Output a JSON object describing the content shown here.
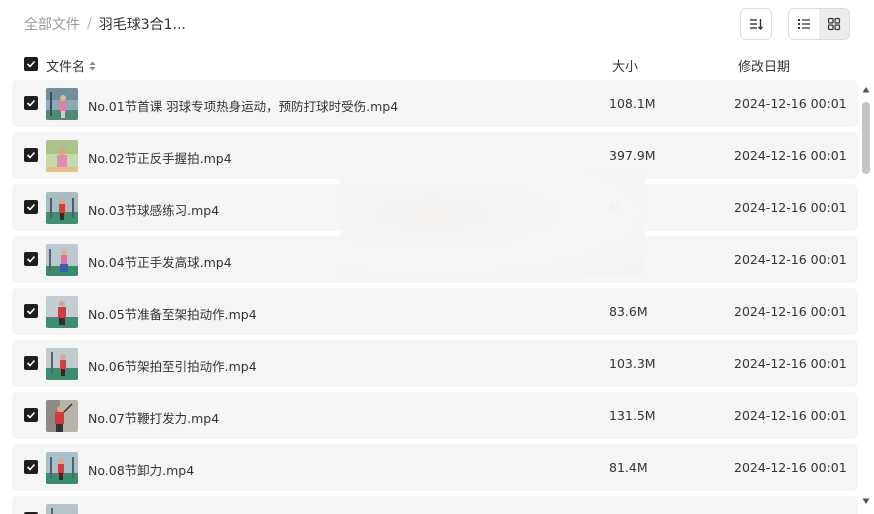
{
  "breadcrumb": {
    "root": "全部文件",
    "separator": "/",
    "current": "羽毛球3合1..."
  },
  "toolbar": {
    "sort_icon": "sort-icon",
    "list_view_icon": "list-view-icon",
    "grid_view_icon": "grid-view-icon"
  },
  "columns": {
    "name": "文件名",
    "size": "大小",
    "date": "修改日期"
  },
  "files": [
    {
      "name": "No.01节首课 羽球专项热身运动，预防打球时受伤.mp4",
      "size": "108.1M",
      "date": "2024-12-16 00:01"
    },
    {
      "name": "No.02节正反手握拍.mp4",
      "size": "397.9M",
      "date": "2024-12-16 00:01"
    },
    {
      "name": "No.03节球感练习.mp4",
      "size": "M",
      "date": "2024-12-16 00:01"
    },
    {
      "name": "No.04节正手发高球.mp4",
      "size": "",
      "date": "2024-12-16 00:01"
    },
    {
      "name": "No.05节准备至架拍动作.mp4",
      "size": "83.6M",
      "date": "2024-12-16 00:01"
    },
    {
      "name": "No.06节架拍至引拍动作.mp4",
      "size": "103.3M",
      "date": "2024-12-16 00:01"
    },
    {
      "name": "No.07节鞭打发力.mp4",
      "size": "131.5M",
      "date": "2024-12-16 00:01"
    },
    {
      "name": "No.08节卸力.mp4",
      "size": "81.4M",
      "date": "2024-12-16 00:01"
    }
  ],
  "colors": {
    "row_bg": "#f5f5f5",
    "checkbox": "#1e1e1e",
    "text": "#333333",
    "muted": "#9a9a9a"
  }
}
